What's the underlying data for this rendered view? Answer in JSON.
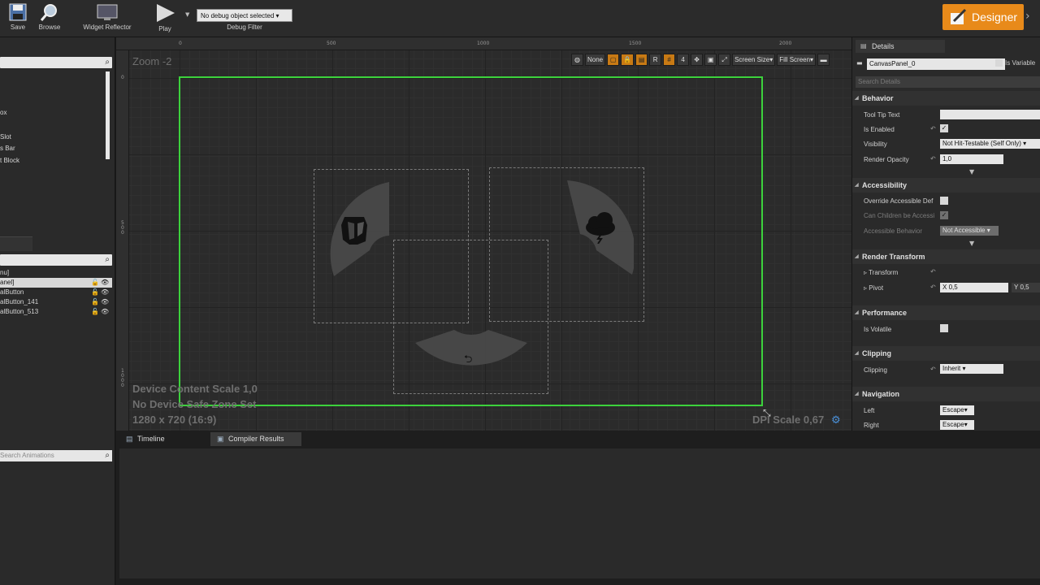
{
  "toolbar": {
    "save_label": "Save",
    "browse_label": "Browse",
    "widget_reflector_label": "Widget Reflector",
    "play_label": "Play",
    "debug_select_value": "No debug object selected",
    "debug_filter_label": "Debug Filter",
    "designer_label": "Designer"
  },
  "left_panel": {
    "palette_items": [
      "ox",
      "Slot",
      "s Bar",
      "t Block"
    ],
    "hierarchy_rows": [
      {
        "label": "nu]"
      },
      {
        "label": "anel]"
      },
      {
        "label": "alButton"
      },
      {
        "label": "alButton_141"
      },
      {
        "label": "alButton_513"
      }
    ]
  },
  "viewport": {
    "zoom_label": "Zoom -2",
    "ruler_top": [
      "0",
      "500",
      "1000",
      "1500",
      "2000"
    ],
    "ruler_left": [
      "0",
      "5\n0\n0",
      "1\n0\n0\n0"
    ],
    "tool_none": "None",
    "tool_r": "R",
    "tool_4": "4",
    "screen_size": "Screen Size",
    "fill_screen": "Fill Screen",
    "device_content_scale": "Device Content Scale 1,0",
    "safe_zone": "No Device Safe Zone Set",
    "resolution": "1280 x 720 (16:9)",
    "dpi_scale": "DPI Scale 0,67"
  },
  "details": {
    "tab_label": "Details",
    "widget_name": "CanvasPanel_0",
    "is_variable_label": "Is Variable",
    "search_placeholder": "Search Details",
    "categories": {
      "behavior": "Behavior",
      "accessibility": "Accessibility",
      "render_transform": "Render Transform",
      "performance": "Performance",
      "clipping": "Clipping",
      "navigation": "Navigation"
    },
    "props": {
      "tool_tip_text": "Tool Tip Text",
      "is_enabled": "Is Enabled",
      "visibility": "Visibility",
      "visibility_value": "Not Hit-Testable (Self Only)",
      "render_opacity": "Render Opacity",
      "render_opacity_value": "1,0",
      "override_accessible": "Override Accessible Def",
      "children_accessible": "Can Children be Accessi",
      "accessible_behavior": "Accessible Behavior",
      "accessible_behavior_value": "Not Accessible",
      "transform": "Transform",
      "pivot": "Pivot",
      "pivot_x_label": "X",
      "pivot_x": "0,5",
      "pivot_y_label": "Y",
      "pivot_y": "0,5",
      "is_volatile": "Is Volatile",
      "clipping": "Clipping",
      "clipping_value": "Inherit",
      "left": "Left",
      "left_value": "Escape",
      "right": "Right",
      "right_value": "Escape"
    }
  },
  "bottom": {
    "search_animations_placeholder": "Search Animations",
    "tab_timeline": "Timeline",
    "tab_compiler": "Compiler Results"
  }
}
